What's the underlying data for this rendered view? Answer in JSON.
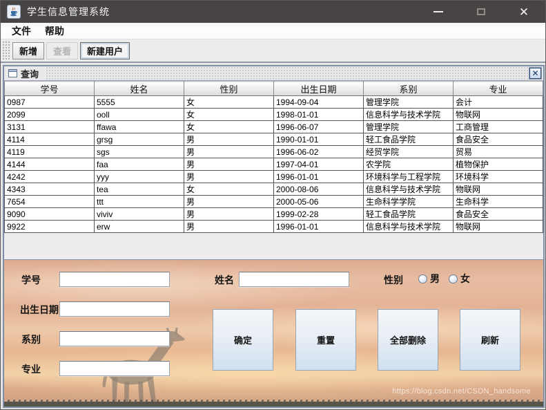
{
  "window": {
    "title": "学生信息管理系统"
  },
  "menu": {
    "items": [
      {
        "label": "文件"
      },
      {
        "label": "帮助"
      }
    ]
  },
  "toolbar": {
    "buttons": [
      {
        "label": "新增",
        "enabled": true
      },
      {
        "label": "查看",
        "enabled": false
      },
      {
        "label": "新建用户",
        "enabled": true
      }
    ]
  },
  "internal_frame": {
    "title": "查询"
  },
  "table": {
    "columns": [
      "学号",
      "姓名",
      "性别",
      "出生日期",
      "系别",
      "专业"
    ],
    "rows": [
      [
        "0987",
        "5555",
        "女",
        "1994-09-04",
        "管理学院",
        "会计"
      ],
      [
        "2099",
        "ooll",
        "女",
        "1998-01-01",
        "信息科学与技术学院",
        "物联网"
      ],
      [
        "3131",
        "ffawa",
        "女",
        "1996-06-07",
        "管理学院",
        "工商管理"
      ],
      [
        "4114",
        "grsg",
        "男",
        "1990-01-01",
        "轻工食品学院",
        "食品安全"
      ],
      [
        "4119",
        "sgs",
        "男",
        "1996-06-02",
        "经贸学院",
        "贸易"
      ],
      [
        "4144",
        "faa",
        "男",
        "1997-04-01",
        "农学院",
        "植物保护"
      ],
      [
        "4242",
        "yyy",
        "男",
        "1996-01-01",
        "环境科学与工程学院",
        "环境科学"
      ],
      [
        "4343",
        "tea",
        "女",
        "2000-08-06",
        "信息科学与技术学院",
        "物联网"
      ],
      [
        "7654",
        "ttt",
        "男",
        "2000-05-06",
        "生命科学学院",
        "生命科学"
      ],
      [
        "9090",
        "viviv",
        "男",
        "1999-02-28",
        "轻工食品学院",
        "食品安全"
      ],
      [
        "9922",
        "erw",
        "男",
        "1996-01-01",
        "信息科学与技术学院",
        "物联网"
      ]
    ]
  },
  "form": {
    "fields": [
      {
        "label": "学号",
        "value": ""
      },
      {
        "label": "姓名",
        "value": ""
      },
      {
        "label": "出生日期",
        "value": ""
      },
      {
        "label": "系别",
        "value": ""
      },
      {
        "label": "专业",
        "value": ""
      }
    ],
    "gender": {
      "label": "性别",
      "options": [
        "男",
        "女"
      ],
      "selected": ""
    },
    "buttons": [
      {
        "label": "确定"
      },
      {
        "label": "重置"
      },
      {
        "label": "全部删除"
      },
      {
        "label": "刷新"
      }
    ]
  },
  "watermark": "https://blog.csdn.net/CSDN_handsome",
  "colors": {
    "titlebar_bg": "#474443",
    "frame_border": "#7e8ea4",
    "toolbar_separator": "#8d99a5",
    "button_gradient_bottom": "#cfe0f1",
    "sunset_top": "#dcab90",
    "sunset_glow": "#f0d0a8"
  }
}
